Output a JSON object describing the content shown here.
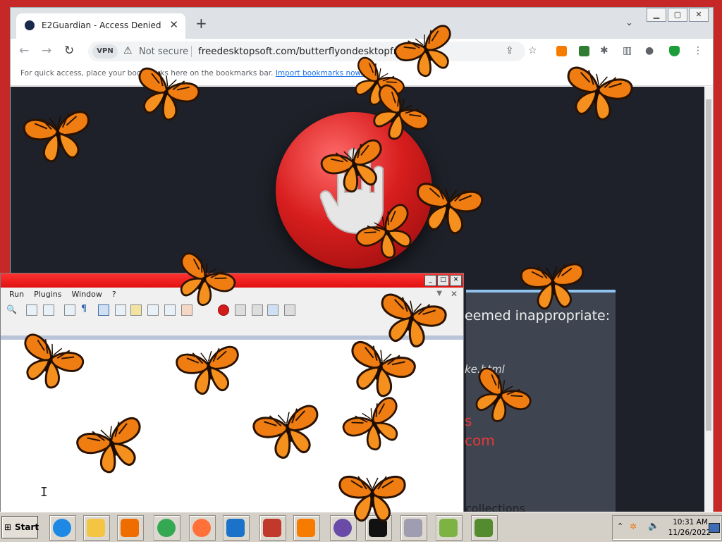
{
  "browser": {
    "tab_title": "E2Guardian - Access Denied",
    "vpn_label": "VPN",
    "not_secure_label": "Not secure",
    "url": "freedesktopsoft.com/butterflyondesktopfree.html",
    "bookmarks_hint": "For quick access, place your bookmarks here on the bookmarks bar.",
    "import_link": "Import bookmarks now..."
  },
  "page": {
    "deny_message": "eemed inappropriate:",
    "deny_url": "ke.html",
    "red_line1": "s",
    "red_line2": "com",
    "footer_text": "collections"
  },
  "editor": {
    "menu": [
      "Run",
      "Plugins",
      "Window",
      "?"
    ]
  },
  "taskbar": {
    "start_label": "Start",
    "clock_time": "10:31 AM",
    "clock_date": "11/26/2022",
    "apps": [
      {
        "name": "internet-explorer",
        "color": "#1e88e5"
      },
      {
        "name": "file-explorer",
        "color": "#f4c542"
      },
      {
        "name": "media-player",
        "color": "#ef6c00"
      },
      {
        "name": "chrome",
        "color": "#34a853"
      },
      {
        "name": "firefox",
        "color": "#ff7139"
      },
      {
        "name": "vscode",
        "color": "#1a73c8"
      },
      {
        "name": "app-red-figure",
        "color": "#c0392b"
      },
      {
        "name": "avast",
        "color": "#f57c00"
      },
      {
        "name": "browser-circle",
        "color": "#6a4ca8"
      },
      {
        "name": "command-prompt",
        "color": "#111111"
      },
      {
        "name": "app-gray",
        "color": "#9e9eb0"
      },
      {
        "name": "notepad-plus-plus",
        "color": "#7cb342"
      },
      {
        "name": "app-frog",
        "color": "#558b2f"
      }
    ]
  },
  "colors": {
    "desktop_red": "#c62828",
    "page_dark": "#1e2129",
    "butterfly_orange": "#f07d12"
  }
}
